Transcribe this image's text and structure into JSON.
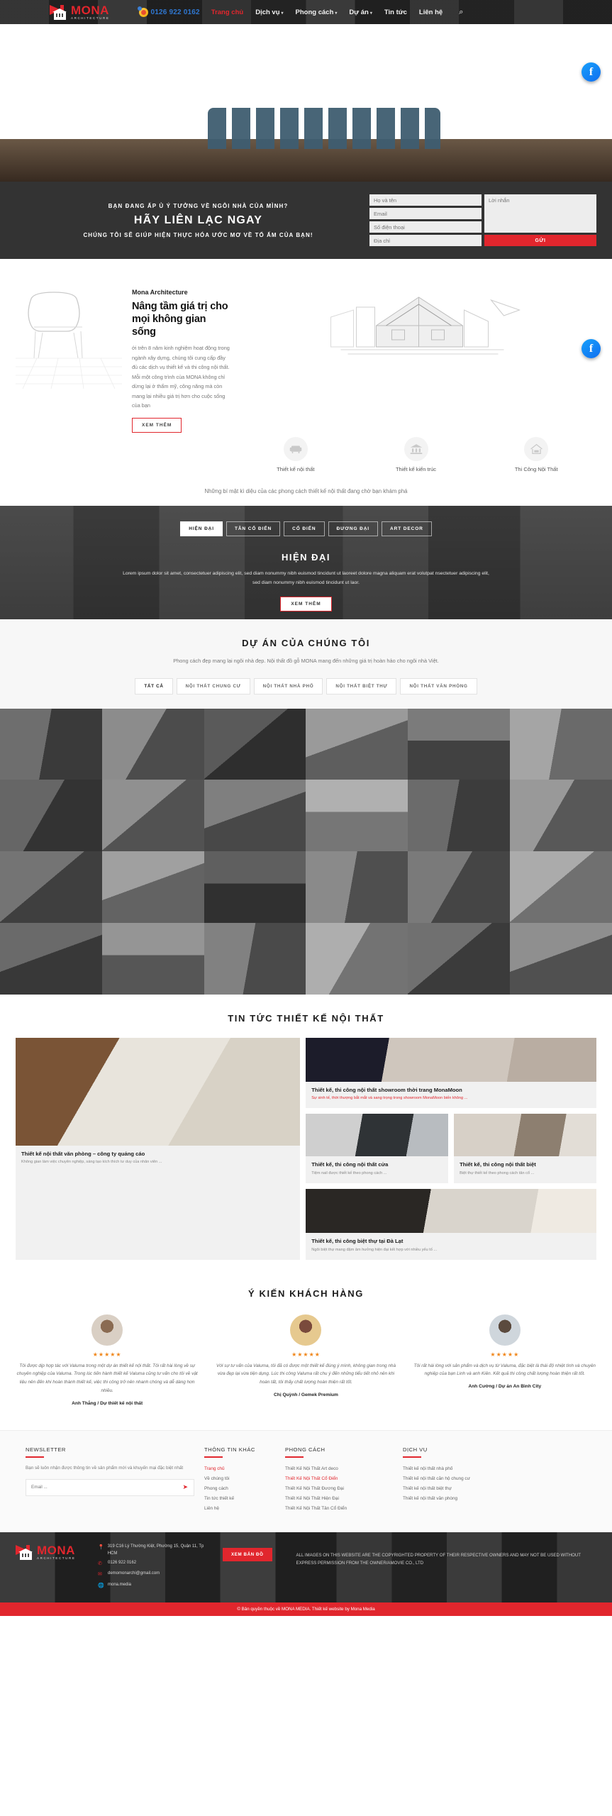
{
  "header": {
    "logo": {
      "name": "MONA",
      "sub": "ARCHITECTURE"
    },
    "phone": "0126 922 0162",
    "nav": [
      {
        "label": "Trang chủ",
        "active": true,
        "caret": false
      },
      {
        "label": "Dịch vụ",
        "active": false,
        "caret": true
      },
      {
        "label": "Phong cách",
        "active": false,
        "caret": true
      },
      {
        "label": "Dự án",
        "active": false,
        "caret": true
      },
      {
        "label": "Tin tức",
        "active": false,
        "caret": false
      },
      {
        "label": "Liên hệ",
        "active": false,
        "caret": false
      }
    ],
    "search_icon": "search-icon"
  },
  "contact": {
    "line1": "BẠN ĐANG ẤP Ủ Ý TƯỞNG VỀ NGÔI NHÀ CỦA MÌNH?",
    "line2": "HÃY LIÊN LẠC NGAY",
    "line3": "CHÚNG TÔI SẼ GIÚP HIỆN THỰC HÓA ƯỚC MƠ VỀ TỔ ẤM CỦA BẠN!",
    "fields": {
      "name": "Họ và tên",
      "email": "Email",
      "phone": "Số điện thoại",
      "address": "Địa chỉ",
      "message": "Lời nhắn"
    },
    "submit": "GỬI"
  },
  "about": {
    "kicker": "Mona Architecture",
    "title": "Nâng tầm giá trị cho mọi không gian sống",
    "paragraph": "ới trên 8 năm kinh nghiệm hoạt động trong ngành xây dựng, chúng tôi cung cấp đầy đủ các dịch vụ thiết kế và thi công nội thất. Mỗi một công trình của MONA không chỉ dừng lại ở thẩm mỹ, công năng mà còn mang lại nhiều giá trị hơn cho cuộc sống của bạn",
    "button": "XEM THÊM",
    "services": [
      {
        "label": "Thiết kế nội thất",
        "icon": "sofa-icon"
      },
      {
        "label": "Thiết kế kiến trúc",
        "icon": "building-icon"
      },
      {
        "label": "Thi Công Nội Thất",
        "icon": "house-icon"
      }
    ],
    "tagline": "Những bí mật kì diệu của các phong cách thiết kế nội thất đang chờ bạn khám phá"
  },
  "styles": {
    "tabs": [
      {
        "label": "HIỆN ĐẠI",
        "active": true
      },
      {
        "label": "TÂN CỔ ĐIỂN",
        "active": false
      },
      {
        "label": "CỔ ĐIỂN",
        "active": false
      },
      {
        "label": "ĐƯƠNG ĐẠI",
        "active": false
      },
      {
        "label": "ART DECOR",
        "active": false
      }
    ],
    "title": "HIỆN ĐẠI",
    "description": "Lorem ipsum dolor sit amet, consectetuer adipiscing elit, sed diam nonummy nibh euismod tincidunt ut laoreet dolore magna aliquam erat volutpat nsectetuer adipiscing elit, sed diam nonummy nibh euismod tincidunt ut laor.",
    "button": "XEM THÊM"
  },
  "projects": {
    "title": "DỰ ÁN CỦA CHÚNG TÔI",
    "subtitle": "Phong cách đẹp mang lại ngôi nhà đẹp. Nội thất đồ gỗ MONA mang đến những giá trị hoàn hảo cho ngôi nhà Việt.",
    "filters": [
      {
        "label": "TẤT CẢ",
        "active": true
      },
      {
        "label": "NỘI THẤT CHUNG CƯ",
        "active": false
      },
      {
        "label": "NỘI THẤT NHÀ PHỐ",
        "active": false
      },
      {
        "label": "NỘI THẤT BIỆT THỰ",
        "active": false
      },
      {
        "label": "NỘI THẤT VĂN PHÒNG",
        "active": false
      }
    ]
  },
  "news": {
    "title": "TIN TỨC THIẾT KẾ NỘI THẤT",
    "main": {
      "title": "Thiết kế nội thất văn phòng – công ty quảng cáo",
      "excerpt": "Không gian làm việc chuyên nghiệp, sáng tạo kích thích tư duy của nhân viên ..."
    },
    "cards": [
      {
        "title": "Thiết kế, thi công nội thất showroom thời trang MonaMoon",
        "excerpt": "Sự sinh tế, thời thượng bắt mắt và sang trọng trong showroom MonaMoon biến không ...",
        "excerpt_red": true
      },
      {
        "title": "Thiết kế, thi công nội thất cửa",
        "excerpt": "Tiệm nail được thiết kế theo phong cách ...",
        "excerpt_red": false
      },
      {
        "title": "Thiết kế, thi công nội thất biệt",
        "excerpt": "Biệt thự thiết kế theo phong cách tân cổ ...",
        "excerpt_red": false
      },
      {
        "title": "Thiết kế, thi công biệt thự tại Đà Lạt",
        "excerpt": "Ngôi biệt thự mang đậm âm hưởng hiện đại kết hợp với nhiều yếu tố ...",
        "excerpt_red": false
      }
    ]
  },
  "testimonials": {
    "title": "Ý KIẾN KHÁCH HÀNG",
    "items": [
      {
        "stars": "★★★★★",
        "text": "Tôi được dịp hợp tác với Valuma trong một dự án thiết kế nội thất. Tôi rất hài lòng về sự chuyên nghiệp của Valuma. Trong lúc tiến hành thiết kế Valuma cũng tư vấn cho tôi về vật liệu nên đến khi hoàn thành thiết kế, việc thi công trở nên nhanh chóng và dễ dàng hơn nhiều.",
        "name": "Anh Thắng / Dự thiết kế nội thất"
      },
      {
        "stars": "★★★★★",
        "text": "Với sự tư vấn của Valuma, tôi đã có được một thiết kế đúng ý mình, không gian trong nhà vừa đẹp lại vừa tiện dụng. Lúc thi công Valuma rất chu ý đến những tiểu tiết nhỏ nên khi hoàn tất, tôi thấy chất lượng hoàn thiện rất tốt.",
        "name": "Chị Quỳnh / Gemek Premium"
      },
      {
        "stars": "★★★★★",
        "text": "Tôi rất hài lòng với sản phẩm và dịch vụ từ Valuma, đặc biệt là thái độ nhiệt tình và chuyên nghiệp của bạn Linh và anh Kiên. Kết quả thi công chất lượng hoàn thiện rất tốt.",
        "name": "Anh Cường / Dự án An Bình City"
      }
    ]
  },
  "footer": {
    "newsletter": {
      "title": "NEWSLETTER",
      "text": "Bạn sẽ luôn nhận được thông tin về sản phẩm mới và khuyến mại đặc biệt nhất",
      "placeholder": "Email ...",
      "send_icon": "send-icon"
    },
    "columns": [
      {
        "title": "THÔNG TIN KHÁC",
        "items": [
          {
            "label": "Trang chủ",
            "red": true
          },
          {
            "label": "Về chúng tôi",
            "red": false
          },
          {
            "label": "Phong cách",
            "red": false
          },
          {
            "label": "Tin tức thiết kế",
            "red": false
          },
          {
            "label": "Liên hệ",
            "red": false
          }
        ]
      },
      {
        "title": "PHONG CÁCH",
        "items": [
          {
            "label": "Thiết Kế Nội Thất Art deco",
            "red": false
          },
          {
            "label": "Thiết Kế Nội Thất Cổ Điển",
            "red": true
          },
          {
            "label": "Thiết Kế Nội Thất Đương Đại",
            "red": false
          },
          {
            "label": "Thiết Kế Nội Thất Hiện Đại",
            "red": false
          },
          {
            "label": "Thiết Kế Nội Thất Tân Cổ Điển",
            "red": false
          }
        ]
      },
      {
        "title": "DỊCH VỤ",
        "items": [
          {
            "label": "Thiết kế nội thất nhà phố",
            "red": false
          },
          {
            "label": "Thiết kế nội thất căn hộ chung cư",
            "red": false
          },
          {
            "label": "Thiết kế nội thất biệt thự",
            "red": false
          },
          {
            "label": "Thiết kế nội thất văn phòng",
            "red": false
          }
        ]
      }
    ],
    "dark": {
      "logo": {
        "name": "MONA",
        "sub": "ARCHITECTURE"
      },
      "address": "319 C16 Lý Thường Kiệt, Phường 15, Quận 11, Tp HCM",
      "phone": "0126 922 0162",
      "email": "demomonarchi@gmail.com",
      "website": "mona.media",
      "map_button": "XEM BẢN ĐỒ",
      "legal": "ALL IMAGES ON THIS WEBSITE ARE THE COPYRIGHTED PROPERTY OF THEIR RESPECTIVE OWNERS AND MAY NOT BE USED WITHOUT EXPRESS PERMISSION FROM THE OWNER/AMOVIE CO., LTD"
    },
    "copyright": "© Bản quyền thuộc về MONA MEDIA. Thiết kế website by Mona Media"
  }
}
